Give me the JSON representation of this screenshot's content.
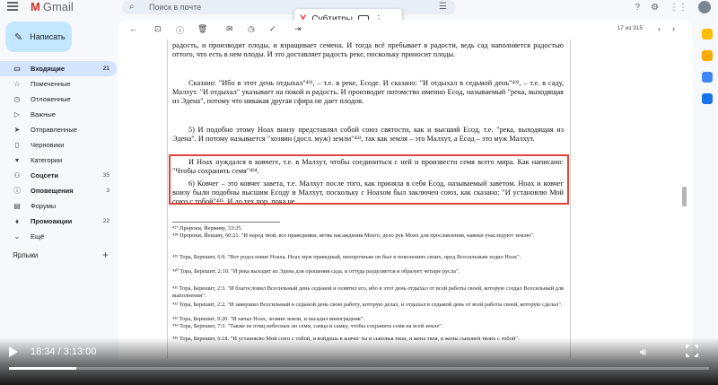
{
  "gmail": {
    "logo_text": "Gmail",
    "search_placeholder": "Поиск в почте",
    "compose_label": "Написать",
    "nav": [
      {
        "label": "Входящие",
        "count": "21",
        "icon": "inbox-icon",
        "glyph": "▭"
      },
      {
        "label": "Помеченные",
        "count": "",
        "icon": "star-icon",
        "glyph": "☆"
      },
      {
        "label": "Отложенные",
        "count": "",
        "icon": "clock-icon",
        "glyph": "◷"
      },
      {
        "label": "Важные",
        "count": "",
        "icon": "important-icon",
        "glyph": "▷"
      },
      {
        "label": "Отправленные",
        "count": "",
        "icon": "send-icon",
        "glyph": "➤"
      },
      {
        "label": "Черновики",
        "count": "",
        "icon": "draft-icon",
        "glyph": "▯"
      },
      {
        "label": "Категории",
        "count": "",
        "icon": "category-icon",
        "glyph": "▾"
      }
    ],
    "categories": [
      {
        "label": "Соцсети",
        "count": "35",
        "icon": "people-icon",
        "glyph": "⚇"
      },
      {
        "label": "Оповещения",
        "count": "3",
        "icon": "info-icon",
        "glyph": "ⓘ"
      },
      {
        "label": "Форумы",
        "count": "",
        "icon": "forum-icon",
        "glyph": "▤"
      },
      {
        "label": "Промоакции",
        "count": "22",
        "icon": "tag-icon",
        "glyph": "⬧"
      }
    ],
    "more_label": "Ещё",
    "labels_heading": "Ярлыки",
    "pager": "17 из 315"
  },
  "yandex": {
    "logo": "Y",
    "subtitles_label": "Субтитры"
  },
  "document": {
    "p1": "радость, и производит плоды, и взращивает семена. И тогда всё пребывает в радости, ведь сад наполняется радостью оттого, что есть в нем плоды. И это доставляет радость реке, поскольку приносит плоды.",
    "p2": "Сказано: \"Ибо в этот день отдыхал\"⁴³¹, – т.е. в реке, Есоде. И сказано: \"И отдыхал в седьмой день\"⁴³², – т.е. в саду, Малхут. \"И отдыхал\" указывает на покой и радость. И производит потомство именно Есод, называемый \"река, выходящая из Эдена\", потому что никакая другая сфира не дает плодов.",
    "p3": "5) И подобно этому Ноах внизу представлял собой союз святости, как и высший Есод, т.е. \"река, выходящая из Эдена\". И потому называется \"хозяин (досл. муж) земли\"⁴³³, так как земля – это Малхут, а Есод – это муж Малхут.",
    "p4": "И Ноах нуждался в ковчеге, т.е. в Малхут, чтобы соединиться с ней и произвести семя всего мира. Как написано: \"Чтобы сохранить семя\"⁴³⁴.",
    "p5": "6) Ковчег – это ковчег завета, т.е. Малхут после того, как приняла в себя Есод, называемый заветом. Ноах и ковчег внизу были подобны высшим Есоду и Малхут, поскольку с Ноахом был заключен союз, как сказано: \"И установлю Мой союз с тобой\"⁴³⁵. И до тех пор, пока не",
    "footnotes": [
      "⁴²⁷ Пророки, Йермияу, 33:25.",
      "⁴²⁸ Пророки, Йешаяу, 60:21. \"И народ твой, все праведники, ветвь насаждения Моего, дело рук Моих для прославления, навеки унаследуют землю\".",
      "⁴²⁹ Тора, Берешит, 6:9. \"Вот родословие Ноаха. Ноах муж праведный, непорочным он был в поколениях своих, пред Всесильным ходил Ноах\".",
      "⁴³⁰ Тора, Берешит, 2:10. \"И река выходит из Эдена для орошения сада, и оттуда разделяется и образует четыре русла\".",
      "⁴³¹ Тора, Берешит, 2:3. \"И благословил Всесильный день седьмой и освятил его, ибо в этот день отдыхал от всей работы своей, которую создал Всесильный для выполнения\".",
      "⁴³² Тора, Берешит, 2:2. \"И завершил Всесильный в седьмой день свою работу, которую делал, и отдыхал в седьмой день от всей работы своей, которую сделал\".",
      "⁴³³ Тора, Берешит, 9:20. \"И начал Ноах, хозяин земли, и насадил виноградник\".",
      "⁴³⁴ Тора, Берешит, 7:3. \"Также из птиц небесных по семи, самца и самку, чтобы сохранить семя на всей земле\".",
      "⁴³⁵ Тора, Берешит, 6:18. \"И установлю Мой союз с тобой, и войдешь в ковчег ты и сыновья твои, и жена твоя, и жены сыновей твоих с тобой\"."
    ]
  },
  "player": {
    "time": "18:34 / 3:13:00",
    "progress": 0.096
  }
}
